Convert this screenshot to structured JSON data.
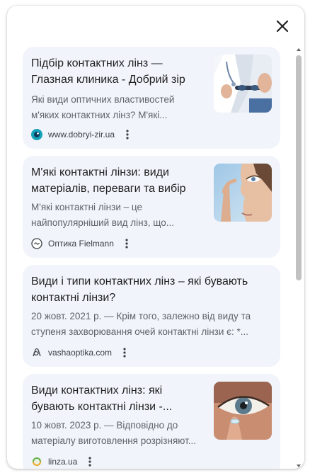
{
  "close_label": "×",
  "results": [
    {
      "title": "Підбір контактних лінз — Глазная клиника - Добрий зір",
      "snippet": "Які види оптичних властивостей м'яких контактних лінз? М'які...",
      "source": "www.dobryi-zir.ua",
      "favicon": "eye-logo-icon",
      "thumbnail": "doctor-holding-lenses-image"
    },
    {
      "title": "М'які контактні лінзи: види матеріалів, переваги та вибір",
      "snippet": "М'які контактні лінзи – це найпопулярніший вид лінз, що...",
      "source": "Оптика Fielmann",
      "favicon": "fielmann-logo-icon",
      "thumbnail": "woman-inserting-lens-image"
    },
    {
      "title": "Види і типи контактних лінз – які бувають контактні лінзи?",
      "snippet": "20 жовт. 2021 р. — Крім того, залежно від виду та ступеня захворювання очей контактні лінзи є: *...",
      "source": "vashaoptika.com",
      "favicon": "vashaoptika-logo-icon",
      "thumbnail": ""
    },
    {
      "title": "Види контактних лінз: які бувають контактні лінзи -...",
      "snippet": "10 жовт. 2023 р. — Відповідно до матеріалу виготовлення розрізняют...",
      "source": "linza.ua",
      "favicon": "linza-logo-icon",
      "thumbnail": "eye-closeup-lens-image"
    }
  ],
  "colors": {
    "card_background": "#f1f4fb",
    "title_text": "#1f1f1f",
    "snippet_text": "#5f6368",
    "scrollbar": "#c1c1c1"
  }
}
